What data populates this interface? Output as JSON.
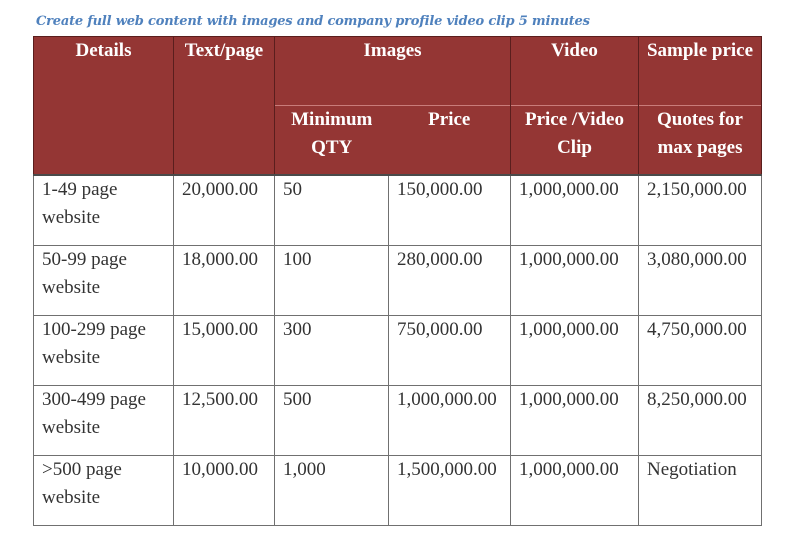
{
  "caption": "Create full web content with images and company profile video clip 5 minutes",
  "colors": {
    "header_bg": "#943634",
    "header_text": "#ffffff",
    "caption": "#4f81bd",
    "body_text": "#333333"
  },
  "table": {
    "header_row1": {
      "details": "Details",
      "text_page": "Text/page",
      "images": "Images",
      "video": "Video",
      "sample_price": "Sample price"
    },
    "header_row2": {
      "min_qty": "Minimum QTY",
      "price": "Price",
      "price_video_clip": "Price /Video Clip",
      "quotes_max_pages": "Quotes for max pages"
    },
    "rows": [
      {
        "details": "1-49 page website",
        "text_page": "20,000.00",
        "min_qty": "50",
        "price": "150,000.00",
        "video": "1,000,000.00",
        "quote": "2,150,000.00"
      },
      {
        "details": "50-99 page website",
        "text_page": "18,000.00",
        "min_qty": "100",
        "price": "280,000.00",
        "video": "1,000,000.00",
        "quote": "3,080,000.00"
      },
      {
        "details": "100-299 page website",
        "text_page": "15,000.00",
        "min_qty": "300",
        "price": "750,000.00",
        "video": "1,000,000.00",
        "quote": "4,750,000.00"
      },
      {
        "details": "300-499 page website",
        "text_page": "12,500.00",
        "min_qty": "500",
        "price": "1,000,000.00",
        "video": "1,000,000.00",
        "quote": "8,250,000.00"
      },
      {
        "details": ">500 page website",
        "text_page": "10,000.00",
        "min_qty": "1,000",
        "price": "1,500,000.00",
        "video": "1,000,000.00",
        "quote": "Negotiation"
      }
    ]
  }
}
